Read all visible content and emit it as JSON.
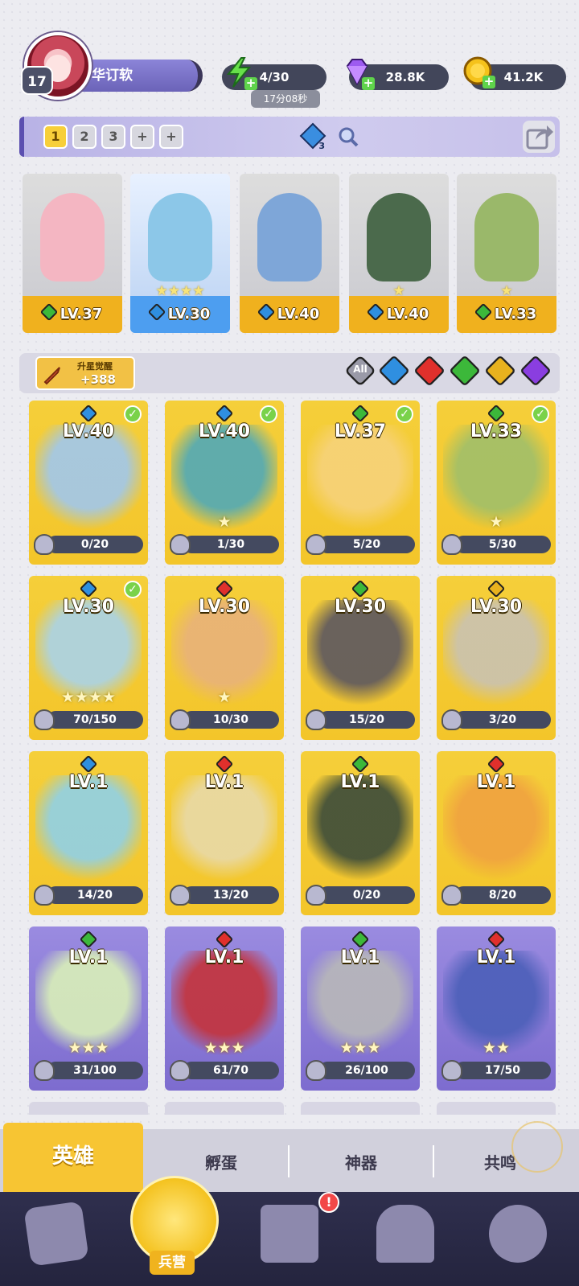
{
  "player": {
    "level": "17",
    "name": "华订软"
  },
  "resources": {
    "energy": "4/30",
    "energy_timer": "17分08秒",
    "gems": "28.8K",
    "coins": "41.2K"
  },
  "team": {
    "slots": [
      "1",
      "2",
      "3",
      "+",
      "+"
    ],
    "power_count": "3",
    "lineup": [
      {
        "level": "LV.37",
        "element": "nature",
        "color": "#f4b6c2",
        "stars": ""
      },
      {
        "level": "LV.30",
        "element": "water",
        "color": "#8cc7e8",
        "stars": "★★★★"
      },
      {
        "level": "LV.40",
        "element": "water",
        "color": "#7ea6d8",
        "stars": ""
      },
      {
        "level": "LV.40",
        "element": "water",
        "color": "#4b6a4c",
        "stars": "★"
      },
      {
        "level": "LV.33",
        "element": "nature",
        "color": "#9ab86a",
        "stars": "★"
      }
    ]
  },
  "filter": {
    "upgrade_label": "升星觉醒",
    "upgrade_value": "+388",
    "all_label": "All",
    "elements": [
      {
        "name": "water",
        "color": "#2f8fe0"
      },
      {
        "name": "fire",
        "color": "#e0302c"
      },
      {
        "name": "nature",
        "color": "#3cb83a"
      },
      {
        "name": "light",
        "color": "#e8b21e"
      },
      {
        "name": "dark",
        "color": "#8a3ee0"
      }
    ]
  },
  "heroes": [
    {
      "level": "LV.40",
      "element": "water",
      "progress": "0/20",
      "stars": "",
      "checked": true,
      "rarity": "gold",
      "art": "#9fc7ee"
    },
    {
      "level": "LV.40",
      "element": "water",
      "progress": "1/30",
      "stars": "★",
      "checked": true,
      "rarity": "gold",
      "art": "#4fa9b8"
    },
    {
      "level": "LV.37",
      "element": "nature",
      "progress": "5/20",
      "stars": "",
      "checked": true,
      "rarity": "gold",
      "art": "#f6d27a"
    },
    {
      "level": "LV.33",
      "element": "nature",
      "progress": "5/30",
      "stars": "★",
      "checked": true,
      "rarity": "gold",
      "art": "#9fbf6a"
    },
    {
      "level": "LV.30",
      "element": "water",
      "progress": "70/150",
      "stars": "★★★★",
      "checked": true,
      "rarity": "gold",
      "art": "#a9d3ea"
    },
    {
      "level": "LV.30",
      "element": "fire",
      "progress": "10/30",
      "stars": "★",
      "checked": false,
      "rarity": "gold",
      "art": "#e8b27a"
    },
    {
      "level": "LV.30",
      "element": "nature",
      "progress": "15/20",
      "stars": "",
      "checked": false,
      "rarity": "gold",
      "art": "#5b5660"
    },
    {
      "level": "LV.30",
      "element": "light",
      "progress": "3/20",
      "stars": "",
      "checked": false,
      "rarity": "gold",
      "art": "#c9c2b2"
    },
    {
      "level": "LV.1",
      "element": "water",
      "progress": "14/20",
      "stars": "",
      "checked": false,
      "rarity": "gold",
      "art": "#8fd0e8"
    },
    {
      "level": "LV.1",
      "element": "fire",
      "progress": "13/20",
      "stars": "",
      "checked": false,
      "rarity": "gold",
      "art": "#e8d9a8"
    },
    {
      "level": "LV.1",
      "element": "nature",
      "progress": "0/20",
      "stars": "",
      "checked": false,
      "rarity": "gold",
      "art": "#3a4a3a"
    },
    {
      "level": "LV.1",
      "element": "fire",
      "progress": "8/20",
      "stars": "",
      "checked": false,
      "rarity": "gold",
      "art": "#f0a240"
    },
    {
      "level": "LV.1",
      "element": "nature",
      "progress": "31/100",
      "stars": "★★★",
      "checked": false,
      "rarity": "purple",
      "art": "#d9f0b8"
    },
    {
      "level": "LV.1",
      "element": "fire",
      "progress": "61/70",
      "stars": "★★★",
      "checked": false,
      "rarity": "purple",
      "art": "#c4323a"
    },
    {
      "level": "LV.1",
      "element": "nature",
      "progress": "26/100",
      "stars": "★★★",
      "checked": false,
      "rarity": "purple",
      "art": "#b8b8b8"
    },
    {
      "level": "LV.1",
      "element": "fire",
      "progress": "17/50",
      "stars": "★★",
      "checked": false,
      "rarity": "purple",
      "art": "#4b5fb8"
    }
  ],
  "subtabs": [
    "英雄",
    "孵蛋",
    "神器",
    "共鸣"
  ],
  "bottom_nav": {
    "active_label": "兵营",
    "badge": "!",
    "icons": [
      "cards-icon",
      "barracks-icon",
      "map-icon",
      "castle-icon",
      "mushroom-icon"
    ]
  }
}
